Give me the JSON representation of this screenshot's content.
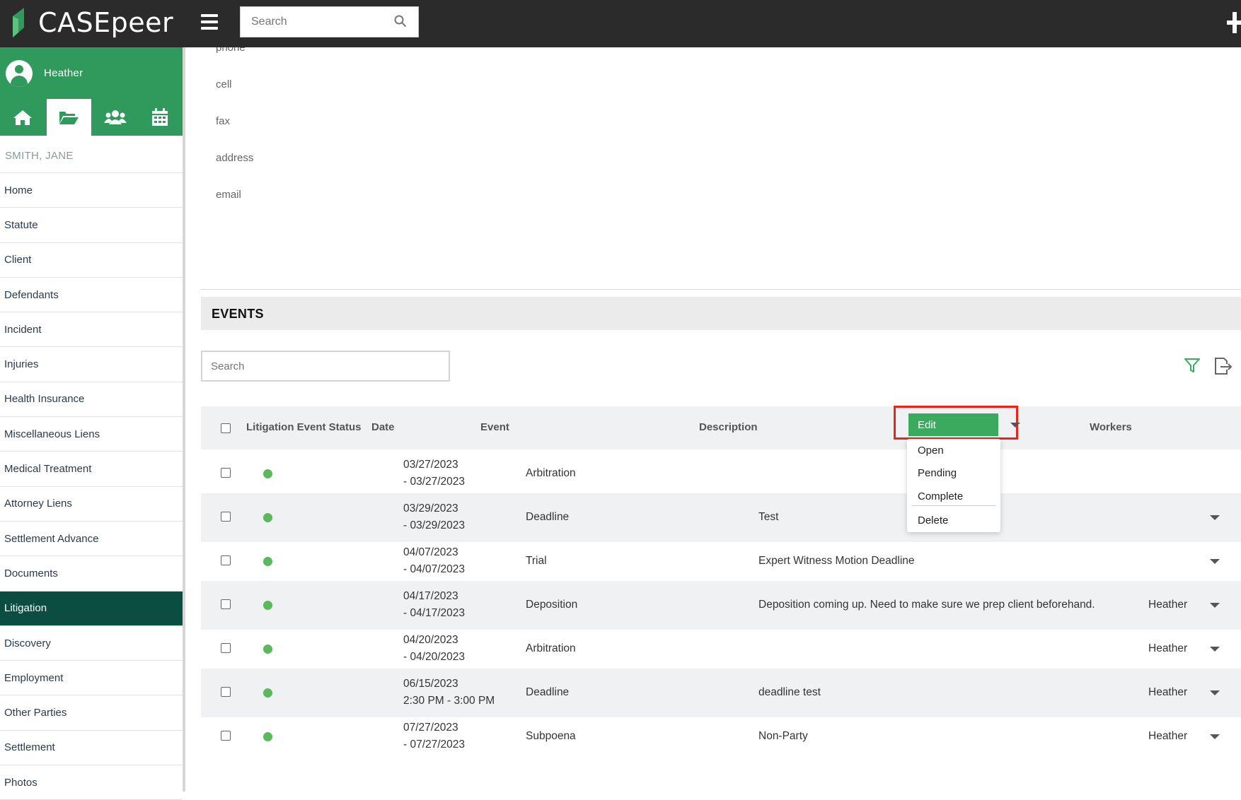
{
  "app": {
    "name": "CASEpeer",
    "brand_color": "#2f9a5c",
    "topbar_color": "#2b2b2b"
  },
  "topbar": {
    "search_placeholder": "Search"
  },
  "user": {
    "name": "Heather"
  },
  "nav_icons": [
    "home-icon",
    "folder-open-icon",
    "users-icon",
    "calendar-icon"
  ],
  "case": {
    "name": "SMITH, JANE"
  },
  "sidebar": {
    "items": [
      {
        "label": "Home"
      },
      {
        "label": "Statute"
      },
      {
        "label": "Client"
      },
      {
        "label": "Defendants"
      },
      {
        "label": "Incident"
      },
      {
        "label": "Injuries"
      },
      {
        "label": "Health Insurance"
      },
      {
        "label": "Miscellaneous Liens"
      },
      {
        "label": "Medical Treatment"
      },
      {
        "label": "Attorney Liens"
      },
      {
        "label": "Settlement Advance"
      },
      {
        "label": "Documents"
      },
      {
        "label": "Litigation"
      },
      {
        "label": "Discovery"
      },
      {
        "label": "Employment"
      },
      {
        "label": "Other Parties"
      },
      {
        "label": "Settlement"
      },
      {
        "label": "Photos"
      }
    ],
    "active": "Litigation",
    "active_color": "#0c4d42"
  },
  "contact": {
    "labels": [
      "phone",
      "cell",
      "fax",
      "address",
      "email"
    ]
  },
  "events": {
    "title": "EVENTS",
    "search_placeholder": "Search",
    "columns": {
      "status": "Litigation Event Status",
      "date": "Date",
      "event": "Event",
      "description": "Description",
      "workers": "Workers"
    },
    "status_color": "#5cb85c",
    "rows": [
      {
        "date1": "03/27/2023",
        "date2": "- 03/27/2023",
        "event": "Arbitration",
        "description": "",
        "worker": ""
      },
      {
        "date1": "03/29/2023",
        "date2": "- 03/29/2023",
        "event": "Deadline",
        "description": "Test",
        "worker": ""
      },
      {
        "date1": "04/07/2023",
        "date2": "- 04/07/2023",
        "event": "Trial",
        "description": "Expert Witness Motion Deadline",
        "worker": ""
      },
      {
        "date1": "04/17/2023",
        "date2": "- 04/17/2023",
        "event": "Deposition",
        "description": "Deposition coming up. Need to make sure we prep client beforehand.",
        "worker": "Heather"
      },
      {
        "date1": "04/20/2023",
        "date2": "- 04/20/2023",
        "event": "Arbitration",
        "description": "",
        "worker": "Heather"
      },
      {
        "date1": "06/15/2023",
        "date2": "2:30 PM - 3:00 PM",
        "event": "Deadline",
        "description": "deadline test",
        "worker": "Heather"
      },
      {
        "date1": "07/27/2023",
        "date2": "- 07/27/2023",
        "event": "Subpoena",
        "description": "Non-Party",
        "worker": "Heather"
      }
    ]
  },
  "action_menu": {
    "edit_label": "Edit",
    "items": [
      "Open",
      "Pending",
      "Complete",
      "Delete"
    ],
    "highlight_color": "#e8251c"
  }
}
